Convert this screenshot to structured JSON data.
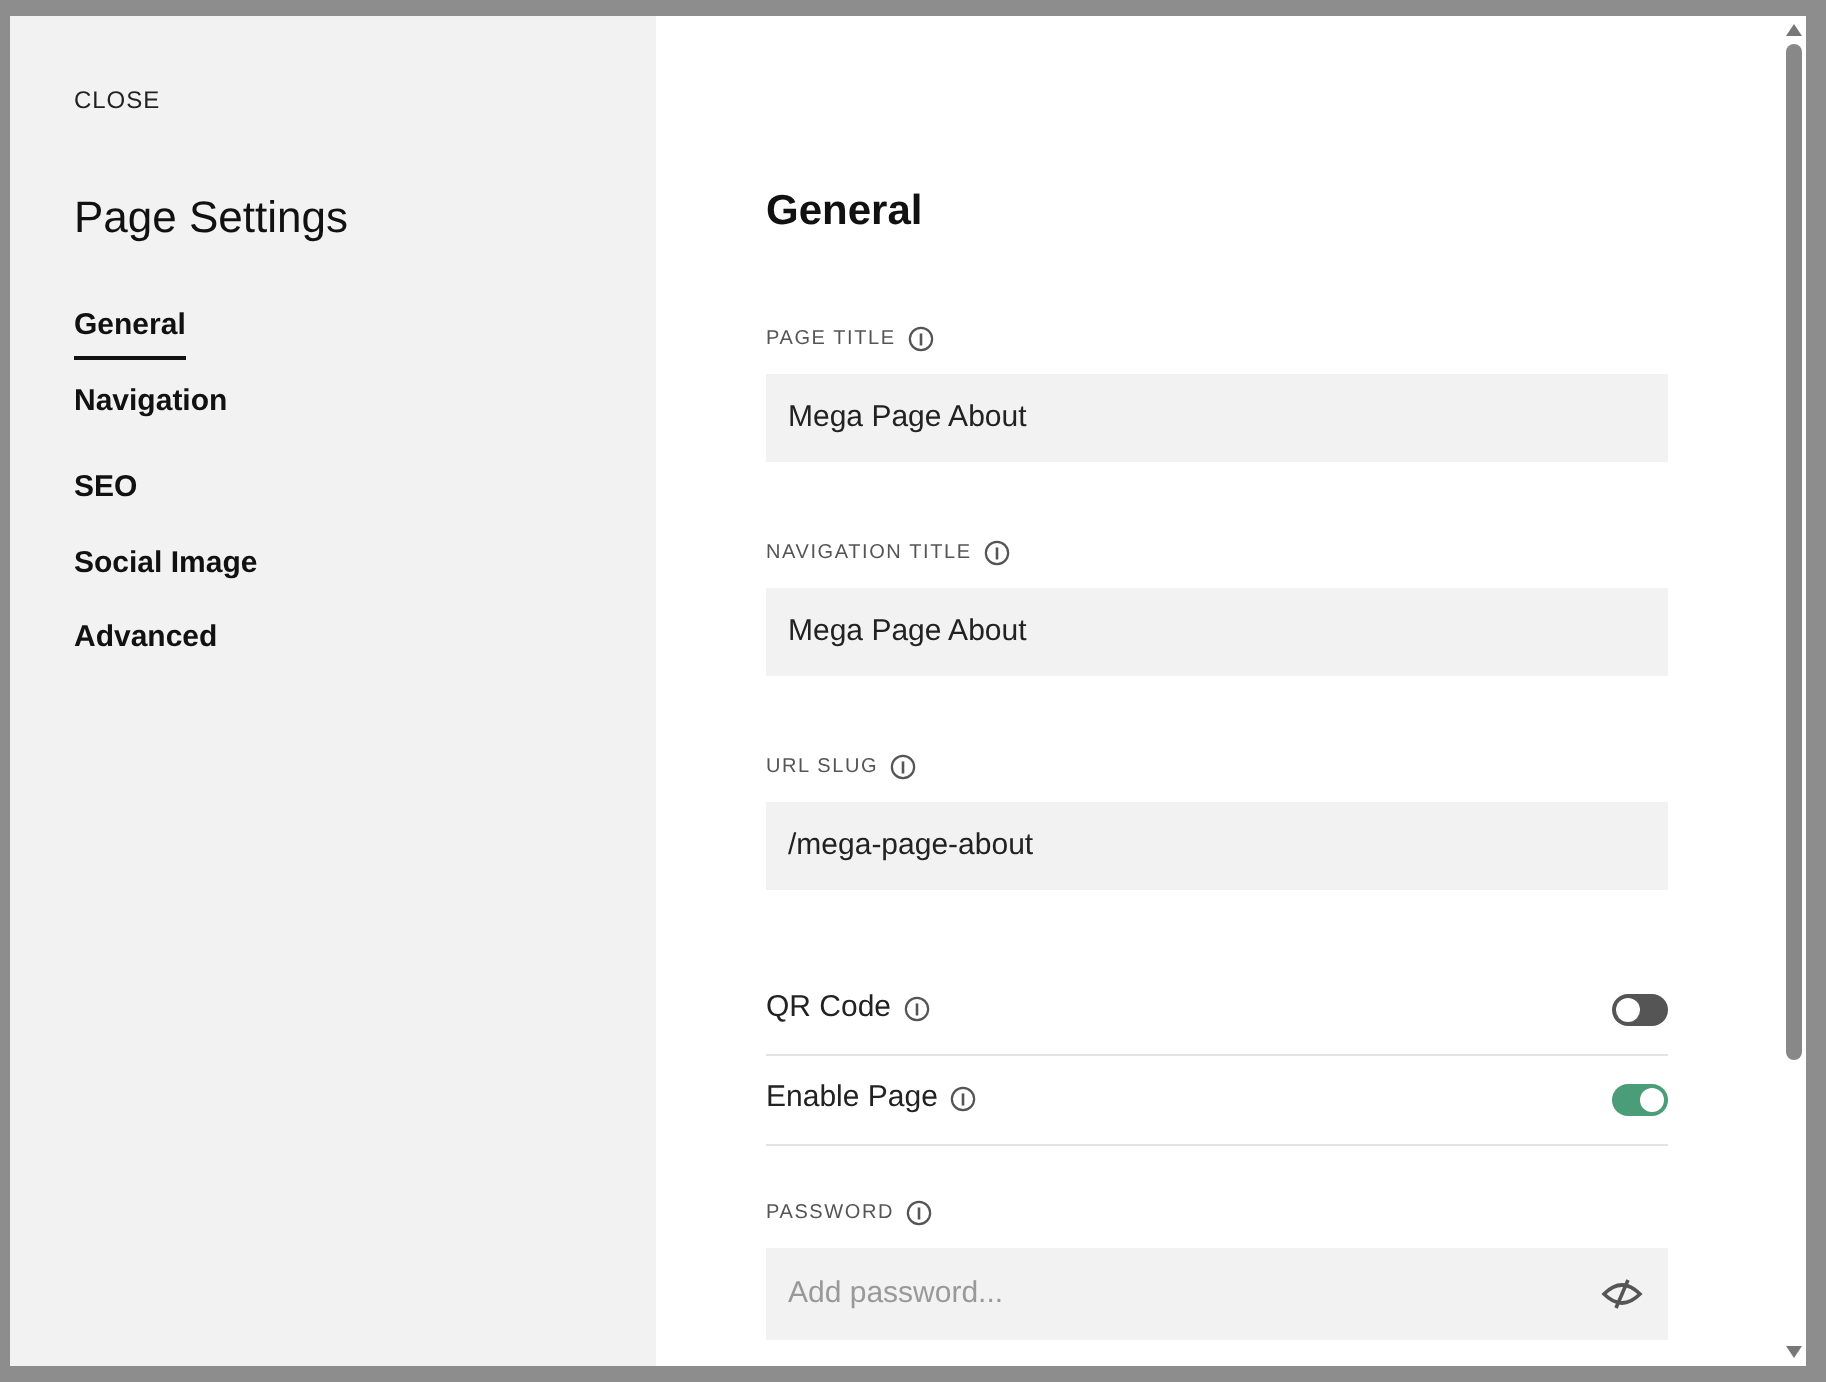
{
  "close": "CLOSE",
  "title": "Page Settings",
  "sidebar": {
    "groups": [
      [
        {
          "label": "General",
          "selected": true
        },
        {
          "label": "Navigation",
          "selected": false
        }
      ],
      [
        {
          "label": "SEO",
          "selected": false
        },
        {
          "label": "Social Image",
          "selected": false
        },
        {
          "label": "Advanced",
          "selected": false
        }
      ]
    ]
  },
  "panel": {
    "heading": "General",
    "fields": [
      {
        "kind": "text",
        "label": "PAGE TITLE",
        "value": "Mega Page About"
      },
      {
        "kind": "text",
        "label": "NAVIGATION TITLE",
        "value": "Mega Page About"
      },
      {
        "kind": "text",
        "label": "URL SLUG",
        "value": "/mega-page-about"
      },
      {
        "kind": "toggle",
        "label": "QR Code",
        "on": false
      },
      {
        "kind": "toggle",
        "label": "Enable Page",
        "on": true
      },
      {
        "kind": "password",
        "label": "PASSWORD",
        "placeholder": "Add password..."
      }
    ]
  }
}
